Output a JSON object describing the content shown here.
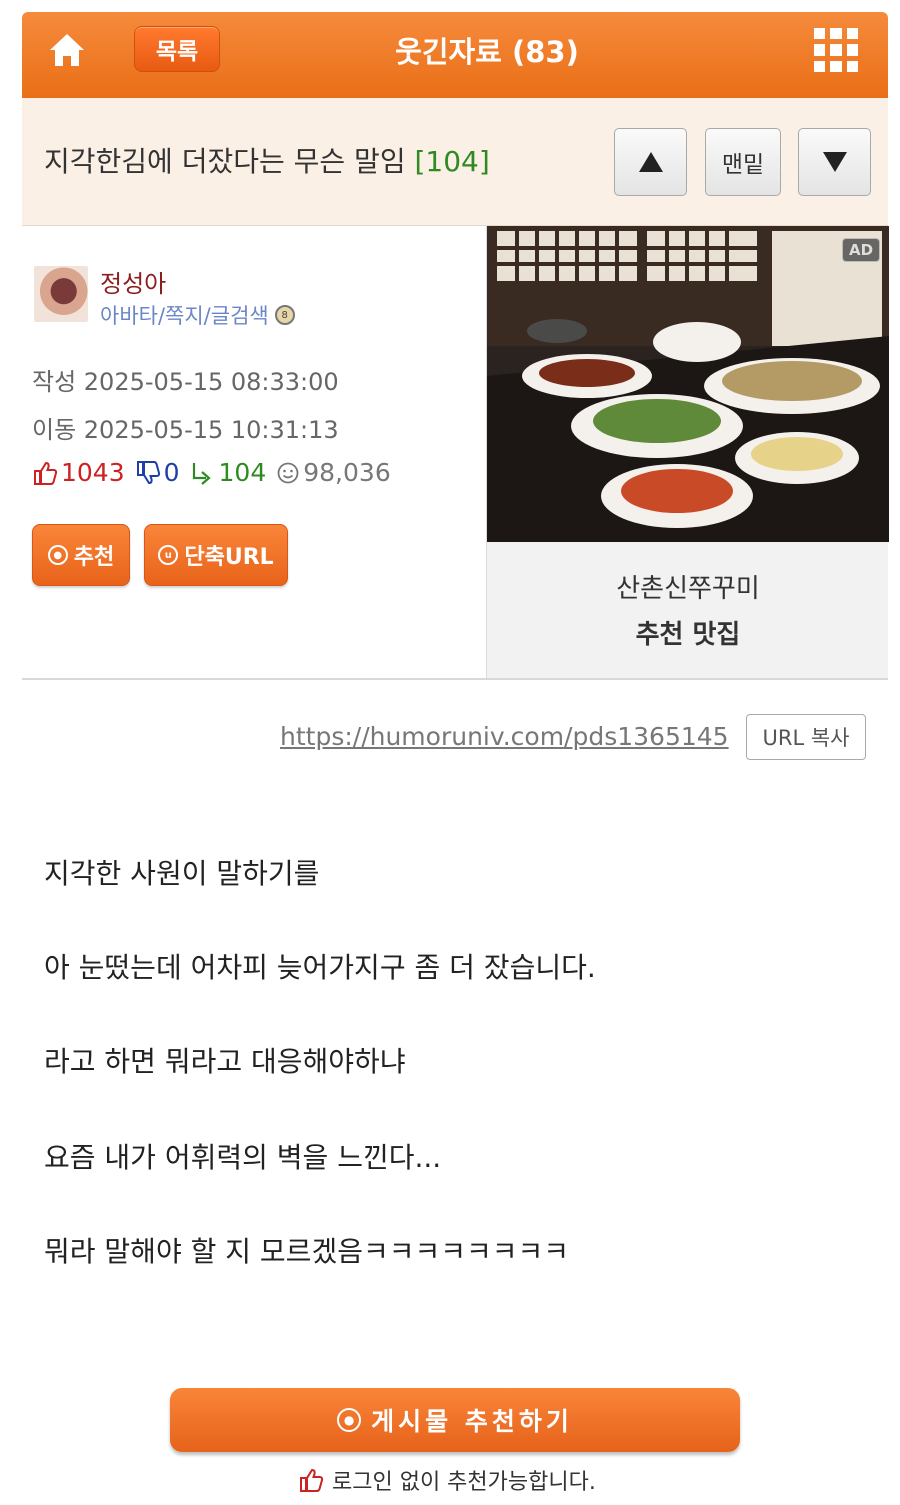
{
  "header": {
    "list_label": "목록",
    "board_title": "웃긴자료 (83)"
  },
  "post": {
    "title": "지각한김에 더잤다는 무슨 말임",
    "comment_count": "[104]",
    "nav_bottom_label": "맨밑"
  },
  "author": {
    "name": "정성아",
    "links": "아바타/쪽지/글검색"
  },
  "meta": {
    "written": "작성 2025-05-15 08:33:00",
    "moved": "이동 2025-05-15 10:31:13"
  },
  "stats": {
    "upvotes": "1043",
    "downvotes": "0",
    "replies": "104",
    "views": "98,036"
  },
  "buttons": {
    "recommend": "추천",
    "short_url": "단축URL",
    "copy_url": "URL 복사",
    "recommend_post": "게시물 추천하기"
  },
  "ad": {
    "tag": "AD",
    "name": "산촌신쭈꾸미",
    "subtitle": "추천 맛집"
  },
  "url": "https://humoruniv.com/pds1365145",
  "content": [
    "지각한 사원이 말하기를",
    "아 눈떴는데 어차피 늦어가지구 좀 더 잤습니다.",
    "라고 하면 뭐라고 대응해야하냐",
    "요즘 내가 어휘력의 벽을 느낀다...",
    "뭐라 말해야 할 지 모르겠음ㅋㅋㅋㅋㅋㅋㅋㅋ"
  ],
  "login_note": "로그인 없이 추천가능합니다.",
  "colors": {
    "accent_orange": "#ea6e17",
    "upvote_red": "#cc2222",
    "downvote_blue": "#1f3ea8",
    "reply_green": "#2f8a22",
    "author_red": "#8b1f1f",
    "link_blue": "#6b86c8"
  }
}
